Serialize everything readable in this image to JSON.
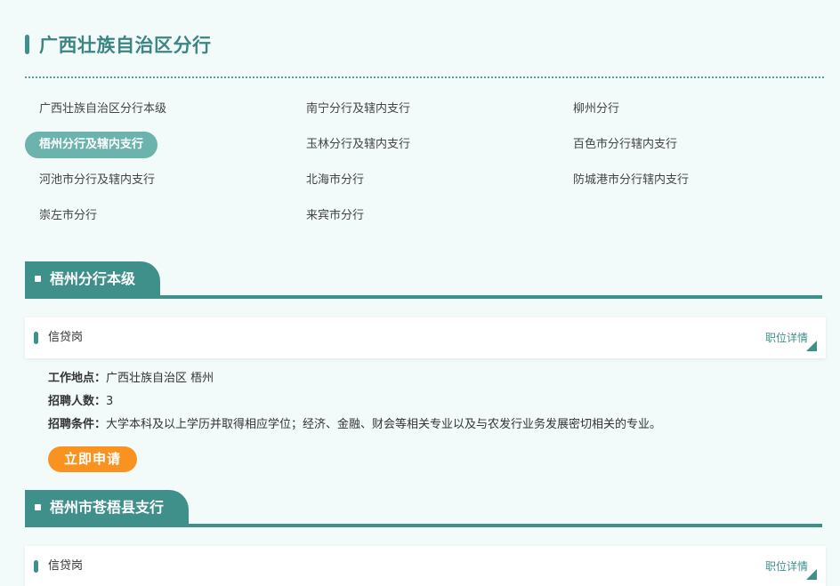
{
  "page": {
    "title": "广西壮族自治区分行"
  },
  "branches": [
    {
      "label": "广西壮族自治区分行本级",
      "active": false
    },
    {
      "label": "南宁分行及辖内支行",
      "active": false
    },
    {
      "label": "柳州分行",
      "active": false
    },
    {
      "label": "梧州分行及辖内支行",
      "active": true
    },
    {
      "label": "玉林分行及辖内支行",
      "active": false
    },
    {
      "label": "百色市分行辖内支行",
      "active": false
    },
    {
      "label": "河池市分行及辖内支行",
      "active": false
    },
    {
      "label": "北海市分行",
      "active": false
    },
    {
      "label": "防城港市分行辖内支行",
      "active": false
    },
    {
      "label": "崇左市分行",
      "active": false
    },
    {
      "label": "来宾市分行",
      "active": false
    }
  ],
  "sections": [
    {
      "title": "梧州分行本级",
      "job": {
        "name": "信贷岗",
        "detail_label": "职位详情"
      },
      "info": {
        "location_label": "工作地点：",
        "location_value": "广西壮族自治区 梧州",
        "count_label": "招聘人数：",
        "count_value": "3",
        "condition_label": "招聘条件：",
        "condition_value": "大学本科及以上学历并取得相应学位；经济、金融、财会等相关专业以及与农发行业务发展密切相关的专业。"
      },
      "apply_label": "立即申请"
    },
    {
      "title": "梧州市苍梧县支行",
      "job": {
        "name": "信贷岗",
        "detail_label": "职位详情"
      }
    }
  ],
  "colors": {
    "accent": "#3f8f8b",
    "active_pill": "#6bb3ac",
    "apply": "#f7931e",
    "background": "#f2fafa"
  }
}
